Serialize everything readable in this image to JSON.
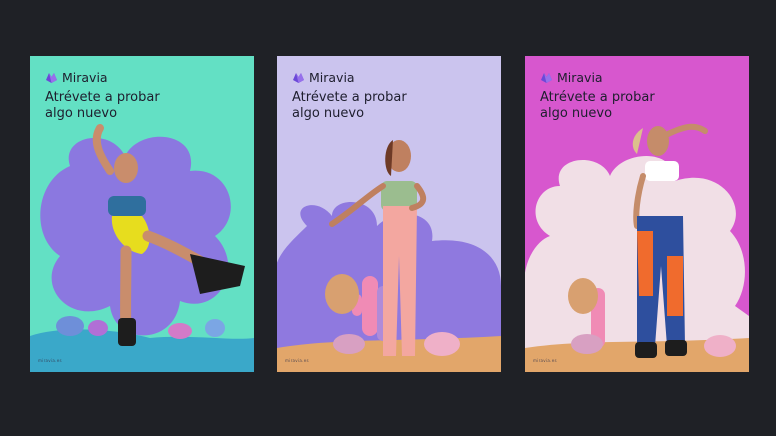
{
  "posters": [
    {
      "brand": "Miravia",
      "headline_line1": "Atrévete a probar",
      "headline_line2": "algo nuevo",
      "footer": "miravia.es",
      "background": "#63e0c4",
      "flower": "#8b78e0",
      "icon": "miravia-logo-icon"
    },
    {
      "brand": "Miravia",
      "headline_line1": "Atrévete a probar",
      "headline_line2": "algo nuevo",
      "footer": "miravia.es",
      "background": "#cbc4ee",
      "flower": "#8f79df",
      "icon": "miravia-logo-icon"
    },
    {
      "brand": "Miravia",
      "headline_line1": "Atrévete a probar",
      "headline_line2": "algo nuevo",
      "footer": "miravia.es",
      "background": "#d757ce",
      "flower": "#f1dfe6",
      "icon": "miravia-logo-icon"
    }
  ]
}
